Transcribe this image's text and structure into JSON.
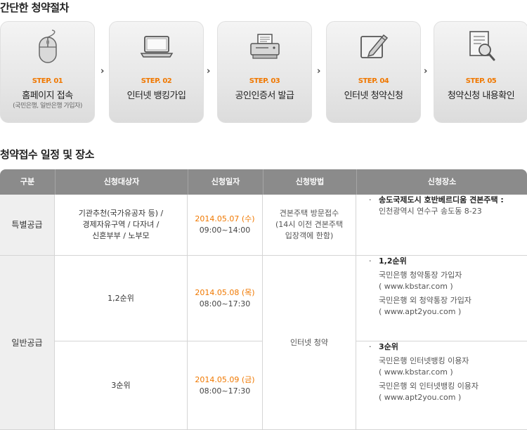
{
  "section1": {
    "title": "간단한 청약절차"
  },
  "steps": [
    {
      "num": "STEP. 01",
      "name": "홈페이지 접속",
      "sub": "(국민은행, 일반은행 가입자)",
      "icon": "mouse-icon"
    },
    {
      "num": "STEP. 02",
      "name": "인터넷 뱅킹가입",
      "sub": "",
      "icon": "laptop-icon"
    },
    {
      "num": "STEP. 03",
      "name": "공인인증서 발급",
      "sub": "",
      "icon": "printer-icon"
    },
    {
      "num": "STEP. 04",
      "name": "인터넷 청약신청",
      "sub": "",
      "icon": "pen-edit-icon"
    },
    {
      "num": "STEP. 05",
      "name": "청약신청 내용확인",
      "sub": "",
      "icon": "document-search-icon"
    }
  ],
  "step_arrow": "›",
  "section2": {
    "title": "청약접수 일정 및 장소"
  },
  "table": {
    "headers": [
      "구분",
      "신청대상자",
      "신청일자",
      "신청방법",
      "신청장소"
    ],
    "special": {
      "category": "특별공급",
      "target_lines": [
        "기관추천(국가유공자 등) /",
        "경제자유구역 / 다자녀 /",
        "신혼부부 / 노부모"
      ],
      "date": "2014.05.07 (수)",
      "time": "09:00~14:00",
      "method_lines": [
        "견본주택 방문접수",
        "(14시 이전 견본주택",
        "입장객에 한함)"
      ],
      "place_bullet": "·",
      "place_title": "송도국제도시 호반베르디움 견본주택 :",
      "place_detail": "인천광역시 연수구 송도동 8-23"
    },
    "general": {
      "category": "일반공급",
      "method": "인터넷 청약",
      "rows": [
        {
          "target": "1,2순위",
          "date": "2014.05.08 (목)",
          "time": "08:00~17:30",
          "place_title": "1,2순위",
          "place_lines": [
            "국민은행 청약통장 가입자",
            "( www.kbstar.com )",
            "국민은행 외 청약통장 가입자",
            "( www.apt2you.com )"
          ]
        },
        {
          "target": "3순위",
          "date": "2014.05.09 (금)",
          "time": "08:00~17:30",
          "place_title": "3순위",
          "place_lines": [
            "국민은행 인터넷뱅킹 이용자",
            "( www.kbstar.com )",
            "국민은행 외 인터넷뱅킹 이용자",
            "( www.apt2you.com )"
          ]
        }
      ]
    }
  },
  "colors": {
    "accent": "#f07800",
    "header_bg": "#8b8b8b",
    "category_bg": "#efefef"
  }
}
